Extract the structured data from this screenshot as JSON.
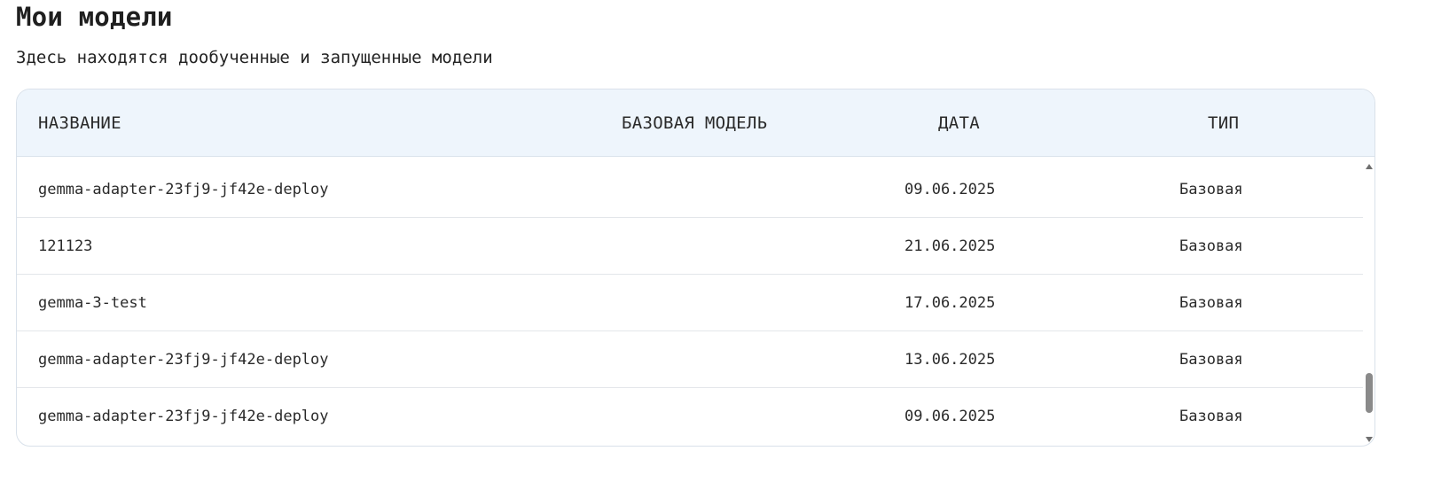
{
  "page": {
    "title": "Мои модели",
    "subtitle": "Здесь находятся дообученные и запущенные модели"
  },
  "table": {
    "columns": {
      "name": "НАЗВАНИЕ",
      "base_model": "БАЗОВАЯ МОДЕЛЬ",
      "date": "ДАТА",
      "type": "ТИП"
    },
    "rows": [
      {
        "name": "gemma-adapter-23fj9-jf42e-deploy",
        "base_model": "",
        "date": "09.06.2025",
        "type": "Базовая"
      },
      {
        "name": "121123",
        "base_model": "",
        "date": "21.06.2025",
        "type": "Базовая"
      },
      {
        "name": "gemma-3-test",
        "base_model": "",
        "date": "17.06.2025",
        "type": "Базовая"
      },
      {
        "name": "gemma-adapter-23fj9-jf42e-deploy",
        "base_model": "",
        "date": "13.06.2025",
        "type": "Базовая"
      },
      {
        "name": "gemma-adapter-23fj9-jf42e-deploy",
        "base_model": "",
        "date": "09.06.2025",
        "type": "Базовая"
      }
    ],
    "scroll_position": 0.9,
    "scroll_visible_fraction": 0.15
  },
  "icons": {
    "scroll_up": "triangle-up-icon",
    "scroll_down": "triangle-down-icon"
  },
  "colors": {
    "header_background": "#eef5fc",
    "border": "#d9e1ea",
    "scroll_thumb": "#8a8a8a"
  }
}
